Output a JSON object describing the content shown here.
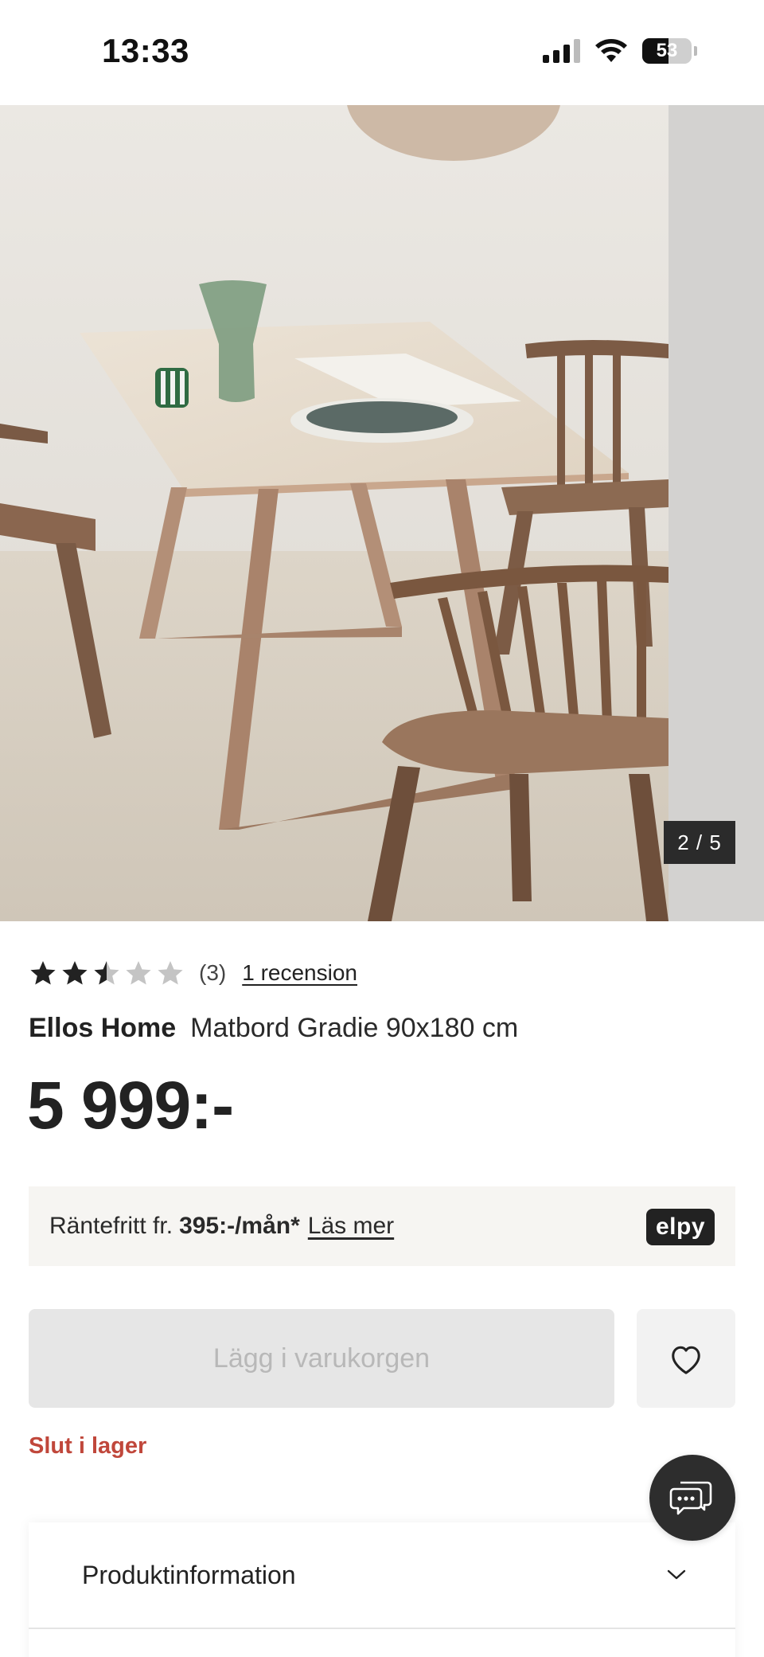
{
  "status_bar": {
    "time": "13:33",
    "battery_percent": "53",
    "battery_level": 0.53
  },
  "gallery": {
    "counter": "2 / 5",
    "current_image": 2,
    "total_images": 5
  },
  "rating": {
    "score": 2.5,
    "max": 5,
    "count_label": "(3)",
    "reviews_link": "1 recension"
  },
  "product": {
    "brand": "Ellos Home",
    "name": "Matbord Gradie 90x180 cm",
    "price": "5 999:-"
  },
  "finance": {
    "prefix": "Räntefritt fr.",
    "amount": "395:-/mån*",
    "link": "Läs mer",
    "provider_logo": "elpy"
  },
  "actions": {
    "add_to_cart": "Lägg i varukorgen",
    "wishlist_icon": "heart-icon"
  },
  "stock": {
    "status": "Slut i lager",
    "color": "#c0473b"
  },
  "chat": {
    "icon": "chat-icon"
  },
  "accordion": {
    "items": [
      {
        "label": "Produktinformation",
        "icon": "chevron-down-icon"
      }
    ]
  },
  "colors": {
    "accent_error": "#c0473b",
    "disabled_button": "#e6e6e6",
    "finance_bg": "#f6f5f2"
  }
}
